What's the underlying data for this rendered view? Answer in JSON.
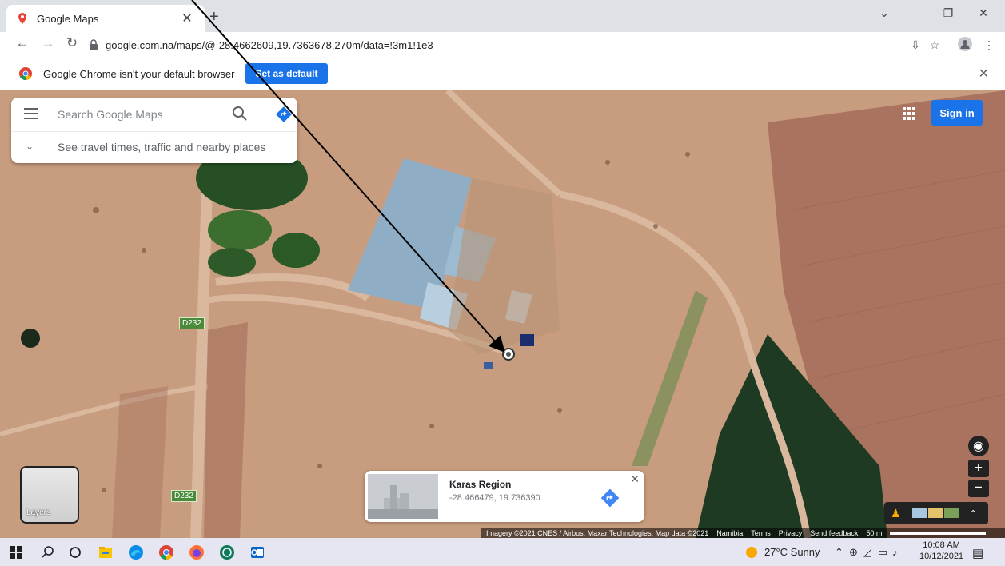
{
  "browser": {
    "tab_title": "Google Maps",
    "url": "google.com.na/maps/@-28.4662609,19.7363678,270m/data=!3m1!1e3",
    "infobar_message": "Google Chrome isn't your default browser",
    "infobar_button": "Set as default"
  },
  "maps": {
    "search_placeholder": "Search Google Maps",
    "travel_hint": "See travel times, traffic and nearby places",
    "sign_in": "Sign in",
    "layers_label": "Layers",
    "road_labels": [
      "D232",
      "D232"
    ],
    "place_card": {
      "name": "Karas Region",
      "coords": "-28.466479, 19.736390"
    },
    "footer": {
      "imagery": "Imagery ©2021 CNES / Airbus, Maxar Technologies, Map data ©2021",
      "country": "Namibia",
      "terms": "Terms",
      "privacy": "Privacy",
      "feedback": "Send feedback",
      "scale": "50 m"
    },
    "colors": {
      "accent": "#1a73e8",
      "direction": "#4285f4"
    }
  },
  "taskbar": {
    "weather": "27°C  Sunny",
    "time": "10:08 AM",
    "date": "10/12/2021"
  }
}
